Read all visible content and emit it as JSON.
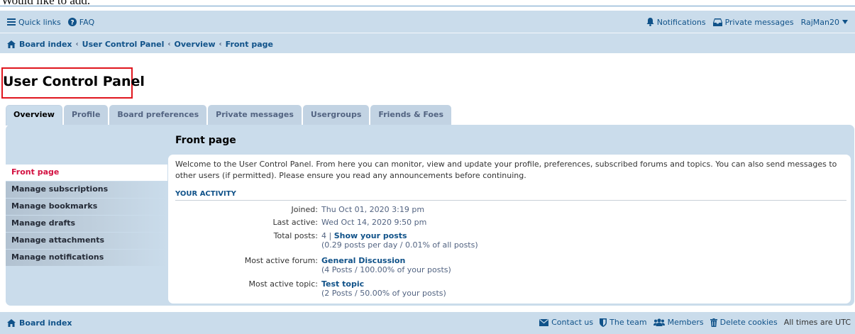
{
  "cut_text": "Would like to add.",
  "nav": {
    "quick_links": "Quick links",
    "faq": "FAQ",
    "notifications": "Notifications",
    "private_messages": "Private messages",
    "username": "RajMan20"
  },
  "breadcrumbs": [
    "Board index",
    "User Control Panel",
    "Overview",
    "Front page"
  ],
  "page_title": "User Control Panel",
  "tabs": [
    "Overview",
    "Profile",
    "Board preferences",
    "Private messages",
    "Usergroups",
    "Friends & Foes"
  ],
  "sidebar": {
    "items": [
      "Front page",
      "Manage subscriptions",
      "Manage bookmarks",
      "Manage drafts",
      "Manage attachments",
      "Manage notifications"
    ]
  },
  "content": {
    "title": "Front page",
    "welcome": "Welcome to the User Control Panel. From here you can monitor, view and update your profile, preferences, subscribed forums and topics. You can also send messages to other users (if permitted). Please ensure you read any announcements before continuing.",
    "section_title": "YOUR ACTIVITY",
    "joined_label": "Joined:",
    "joined_value": "Thu Oct 01, 2020 3:19 pm",
    "last_active_label": "Last active:",
    "last_active_value": "Wed Oct 14, 2020 9:50 pm",
    "total_posts_label": "Total posts:",
    "total_posts_value": "4 |",
    "show_posts": "Show your posts",
    "total_posts_sub": "(0.29 posts per day / 0.01% of all posts)",
    "active_forum_label": "Most active forum:",
    "active_forum_value": "General Discussion",
    "active_forum_sub": "(4 Posts / 100.00% of your posts)",
    "active_topic_label": "Most active topic:",
    "active_topic_value": "Test topic",
    "active_topic_sub": "(2 Posts / 50.00% of your posts)"
  },
  "footer": {
    "board_index": "Board index",
    "contact": "Contact us",
    "team": "The team",
    "members": "Members",
    "delete_cookies": "Delete cookies",
    "timezone": "All times are UTC"
  },
  "colors": {
    "nav_bg": "#cadceb",
    "link": "#105289",
    "active_menu": "#d31141",
    "highlight_box": "#e0161e"
  }
}
